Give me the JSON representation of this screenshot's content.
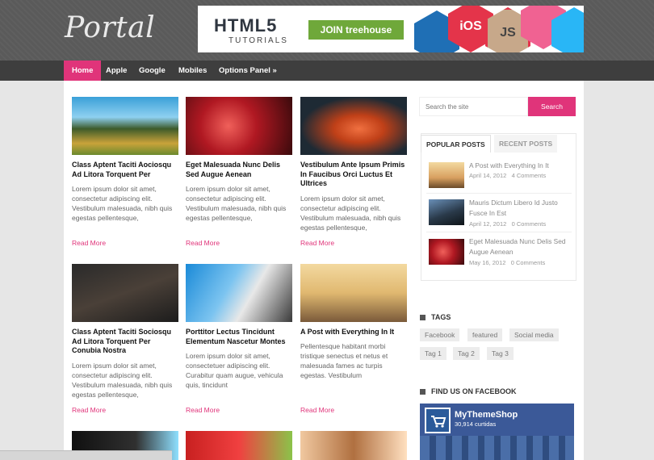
{
  "header": {
    "logo_text": "Portal",
    "banner": {
      "headline": "HTML5",
      "subline": "TUTORIALS",
      "cta": "JOIN treehouse",
      "hex_labels": [
        "iOS",
        "JS"
      ]
    }
  },
  "nav": {
    "items": [
      {
        "label": "Home",
        "active": true
      },
      {
        "label": "Apple",
        "active": false
      },
      {
        "label": "Google",
        "active": false
      },
      {
        "label": "Mobiles",
        "active": false
      },
      {
        "label": "Options Panel »",
        "active": false
      }
    ]
  },
  "posts": [
    {
      "title": "Class Aptent Taciti Aociosqu Ad Litora Torquent Per",
      "excerpt": "Lorem ipsum dolor sit amet, consectetur adipiscing elit. Vestibulum malesuada, nibh quis egestas pellentesque,",
      "read_more": "Read More"
    },
    {
      "title": "Eget Malesuada Nunc Delis Sed Augue Aenean",
      "excerpt": "Lorem ipsum dolor sit amet, consectetur adipiscing elit. Vestibulum malesuada, nibh quis egestas pellentesque,",
      "read_more": "Read More"
    },
    {
      "title": "Vestibulum Ante Ipsum Primis In Faucibus Orci Luctus Et Ultrices",
      "excerpt": "Lorem ipsum dolor sit amet, consectetur adipiscing elit. Vestibulum malesuada, nibh quis egestas pellentesque,",
      "read_more": "Read More"
    },
    {
      "title": "Class Aptent Taciti Sociosqu Ad Litora Torquent Per Conubia Nostra",
      "excerpt": "Lorem ipsum dolor sit amet, consectetur adipiscing elit. Vestibulum malesuada, nibh quis egestas pellentesque,",
      "read_more": "Read More"
    },
    {
      "title": "Porttitor Lectus Tincidunt Elementum Nascetur Montes",
      "excerpt": "Lorem ipsum dolor sit amet, consectetuer adipiscing elit. Curabitur quam augue, vehicula quis, tincidunt",
      "read_more": "Read More"
    },
    {
      "title": "A Post with Everything In It",
      "excerpt": "Pellentesque habitant morbi tristique senectus et netus et malesuada fames ac turpis egestas. Vestibulum",
      "read_more": "Read More"
    }
  ],
  "sidebar": {
    "search": {
      "placeholder": "Search the site",
      "button": "Search"
    },
    "tabs": [
      {
        "label": "POPULAR POSTS",
        "active": true
      },
      {
        "label": "RECENT POSTS",
        "active": false
      }
    ],
    "popular_posts": [
      {
        "title": "A Post with Everything In It",
        "date": "April 14, 2012",
        "comments": "4 Comments"
      },
      {
        "title": "Mauris Dictum Libero Id Justo Fusce In Est",
        "date": "April 12, 2012",
        "comments": "0 Comments"
      },
      {
        "title": "Eget Malesuada Nunc Delis Sed Augue Aenean",
        "date": "May 16, 2012",
        "comments": "0 Comments"
      }
    ],
    "tags_title": "TAGS",
    "tags": [
      "Facebook",
      "featured",
      "Social media",
      "Tag 1",
      "Tag 2",
      "Tag 3"
    ],
    "facebook_title": "FIND US ON FACEBOOK",
    "facebook": {
      "page_name": "MyThemeShop",
      "likes": "30,914 curtidas"
    }
  },
  "colors": {
    "accent": "#e0347a",
    "nav_bg": "#3e3e3e",
    "header_bg": "#5a5a5a",
    "facebook": "#3b5998"
  }
}
